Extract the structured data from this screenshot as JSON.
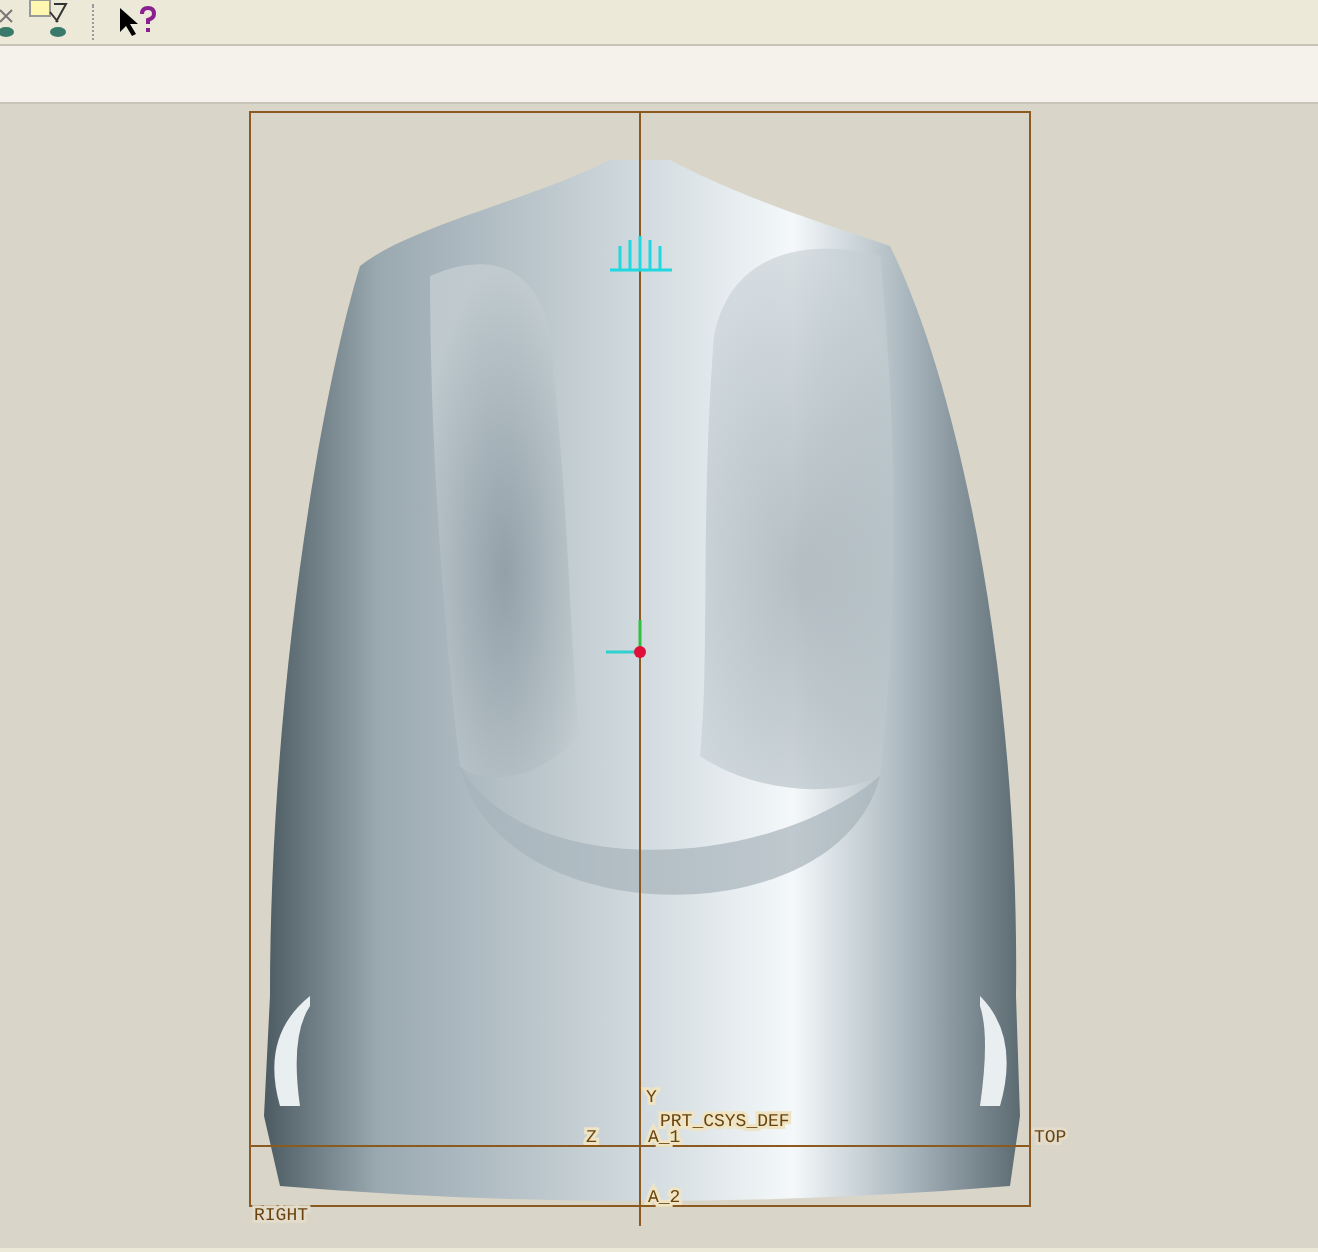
{
  "viewport": {
    "labels": [
      {
        "kind": "csys",
        "text": "PRT_CSYS_DEF"
      },
      {
        "kind": "axis",
        "text": "A_1"
      },
      {
        "kind": "axis",
        "text": "A_2"
      },
      {
        "kind": "plane",
        "text": "TOP"
      },
      {
        "kind": "plane",
        "text": "RIGHT"
      },
      {
        "kind": "dir",
        "text": "Y"
      },
      {
        "kind": "dir",
        "text": "Z"
      }
    ]
  }
}
